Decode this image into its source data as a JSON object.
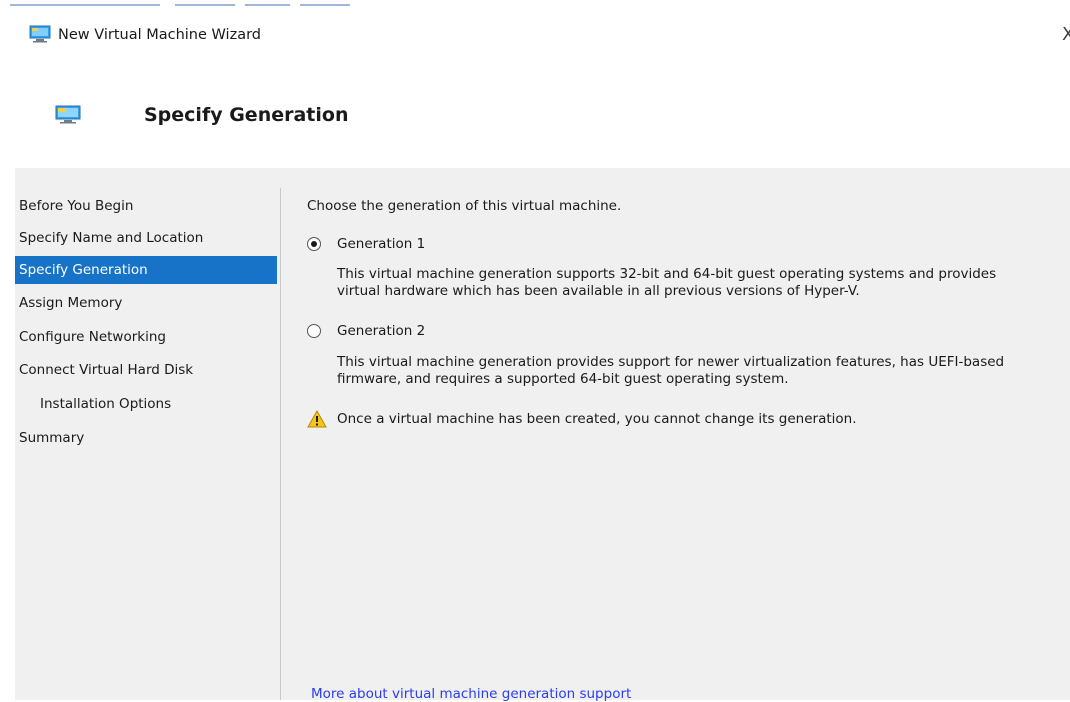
{
  "window": {
    "title": "New Virtual Machine Wizard",
    "close_glyph": "X",
    "app_icon": "monitor-icon"
  },
  "header": {
    "title": "Specify Generation",
    "icon": "monitor-icon"
  },
  "steps": [
    {
      "label": "Before You Begin",
      "active": false,
      "indent": false
    },
    {
      "label": "Specify Name and Location",
      "active": false,
      "indent": false
    },
    {
      "label": "Specify Generation",
      "active": true,
      "indent": false
    },
    {
      "label": "Assign Memory",
      "active": false,
      "indent": false
    },
    {
      "label": "Configure Networking",
      "active": false,
      "indent": false
    },
    {
      "label": "Connect Virtual Hard Disk",
      "active": false,
      "indent": false
    },
    {
      "label": "Installation Options",
      "active": false,
      "indent": true
    },
    {
      "label": "Summary",
      "active": false,
      "indent": false
    }
  ],
  "main": {
    "intro": "Choose the generation of this virtual machine.",
    "options": [
      {
        "label": "Generation 1",
        "selected": true,
        "description_lines": [
          "This virtual machine generation supports 32-bit and 64-bit guest operating systems and provides",
          "virtual hardware which has been available in all previous versions of Hyper-V."
        ]
      },
      {
        "label": "Generation 2",
        "selected": false,
        "description_lines": [
          "This virtual machine generation provides support for newer virtualization features, has UEFI-based",
          "firmware, and requires a supported 64-bit guest operating system."
        ]
      }
    ],
    "warning": "Once a virtual machine has been created, you cannot change its generation.",
    "warning_icon": "warning-icon",
    "more_link": "More about virtual machine generation support"
  },
  "colors": {
    "active_step": "#1673c8",
    "panel_bg": "#f0f0f0",
    "link": "#2a3df0"
  }
}
